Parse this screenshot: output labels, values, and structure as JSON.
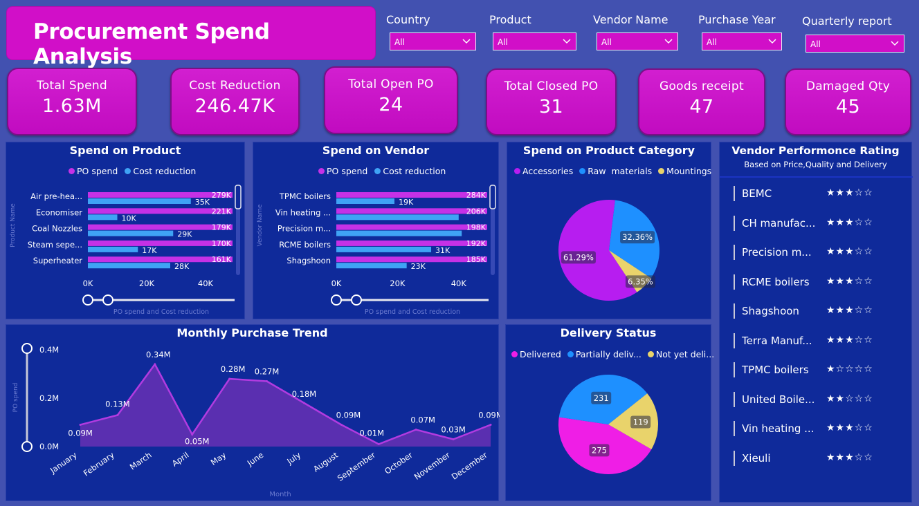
{
  "header": {
    "title": "Procurement Spend Analysis"
  },
  "filters": [
    {
      "label": "Country",
      "value": "All"
    },
    {
      "label": "Product",
      "value": "All"
    },
    {
      "label": "Vendor Name",
      "value": "All"
    },
    {
      "label": "Purchase Year",
      "value": "All"
    },
    {
      "label": "Quarterly report",
      "value": "All"
    }
  ],
  "kpis": [
    {
      "label": "Total Spend",
      "value": "1.63M"
    },
    {
      "label": "Cost Reduction",
      "value": "246.47K"
    },
    {
      "label": "Total Open PO",
      "value": "24"
    },
    {
      "label": "Total Closed PO",
      "value": "31"
    },
    {
      "label": "Goods receipt",
      "value": "47"
    },
    {
      "label": "Damaged Qty",
      "value": "45"
    }
  ],
  "colors": {
    "po_spend": "#c531e6",
    "cost_reduction": "#3fa3f5",
    "accessories": "#b71df0",
    "raw_materials": "#1e90ff",
    "mountings": "#e9d36b",
    "delivered": "#ef1ee6",
    "partially": "#1e90ff",
    "not_yet": "#e9d36b",
    "area": "#5a2fb0",
    "area_line": "#b23be0"
  },
  "rating_panel": {
    "title": "Vendor Performonce Rating",
    "subtitle": "Based on Price,Quality and Delivery",
    "vendors": [
      {
        "name": "BEMC",
        "stars": "★★★☆☆"
      },
      {
        "name": "CH manufac...",
        "stars": "★★★☆☆"
      },
      {
        "name": "Precision m...",
        "stars": "★★★☆☆"
      },
      {
        "name": "RCME boilers",
        "stars": "★★★☆☆"
      },
      {
        "name": "Shagshoon",
        "stars": "★★★☆☆"
      },
      {
        "name": "Terra Manuf...",
        "stars": "★★★☆☆"
      },
      {
        "name": "TPMC boilers",
        "stars": "★☆☆☆☆"
      },
      {
        "name": "United Boile...",
        "stars": "★★☆☆☆"
      },
      {
        "name": "Vin heating ...",
        "stars": "★★★☆☆"
      },
      {
        "name": "Xieuli",
        "stars": "★★★☆☆"
      }
    ]
  },
  "chart_data": [
    {
      "id": "spend_on_product",
      "type": "bar",
      "orientation": "horizontal",
      "title": "Spend on Product",
      "xlabel": "PO spend and Cost reduction",
      "ylabel": "Product Name",
      "categories": [
        "Air pre-hea...",
        "Economiser",
        "Coal Nozzles",
        "Steam sepe...",
        "Superheater"
      ],
      "series": [
        {
          "name": "PO spend",
          "values": [
            279,
            221,
            179,
            170,
            161
          ],
          "labels": [
            "279K",
            "221K",
            "179K",
            "170K",
            "161K"
          ]
        },
        {
          "name": "Cost reduction",
          "values": [
            35,
            10,
            29,
            17,
            28
          ],
          "labels": [
            "35K",
            "10K",
            "29K",
            "17K",
            "28K"
          ]
        }
      ],
      "xticks": [
        "0K",
        "20K",
        "40K"
      ],
      "xlim": [
        0,
        50
      ]
    },
    {
      "id": "spend_on_vendor",
      "type": "bar",
      "orientation": "horizontal",
      "title": "Spend on Vendor",
      "xlabel": "PO spend and Cost reduction",
      "ylabel": "Vendor Name",
      "categories": [
        "TPMC boilers",
        "Vin heating ...",
        "Precision m...",
        "RCME boilers",
        "Shagshoon"
      ],
      "series": [
        {
          "name": "PO spend",
          "values": [
            284,
            206,
            198,
            192,
            185
          ],
          "labels": [
            "284K",
            "206K",
            "198K",
            "192K",
            "185K"
          ]
        },
        {
          "name": "Cost reduction",
          "values": [
            19,
            40,
            41,
            31,
            23
          ],
          "labels": [
            "19K",
            "",
            "",
            "31K",
            "23K"
          ]
        }
      ],
      "xticks": [
        "0K",
        "20K",
        "40K"
      ],
      "xlim": [
        0,
        50
      ]
    },
    {
      "id": "spend_on_category",
      "type": "pie",
      "title": "Spend on Product Category",
      "labels": [
        "Accessories",
        "Raw  materials",
        "Mountings"
      ],
      "values": [
        61.29,
        32.36,
        6.35
      ],
      "value_labels": [
        "61.29%",
        "32.36%",
        "6.35%"
      ]
    },
    {
      "id": "monthly_trend",
      "type": "area",
      "title": "Monthly Purchase Trend",
      "xlabel": "Month",
      "ylabel": "PO spend",
      "categories": [
        "January",
        "February",
        "March",
        "April",
        "May",
        "June",
        "July",
        "August",
        "September",
        "October",
        "November",
        "December"
      ],
      "values": [
        0.09,
        0.13,
        0.34,
        0.05,
        0.28,
        0.27,
        0.18,
        0.09,
        0.01,
        0.07,
        0.03,
        0.09
      ],
      "value_labels": [
        "0.09M",
        "0.13M",
        "0.34M",
        "0.05M",
        "0.28M",
        "0.27M",
        "0.18M",
        "0.09M",
        "0.01M",
        "0.07M",
        "0.03M",
        "0.09M"
      ],
      "yticks": [
        "0.0M",
        "0.2M",
        "0.4M"
      ],
      "ylim": [
        0,
        0.4
      ]
    },
    {
      "id": "delivery_status",
      "type": "pie",
      "title": "Delivery Status",
      "labels": [
        "Delivered",
        "Partially deliv...",
        "Not yet deli..."
      ],
      "values": [
        275,
        231,
        119
      ],
      "value_labels": [
        "275",
        "231",
        "119"
      ]
    }
  ]
}
